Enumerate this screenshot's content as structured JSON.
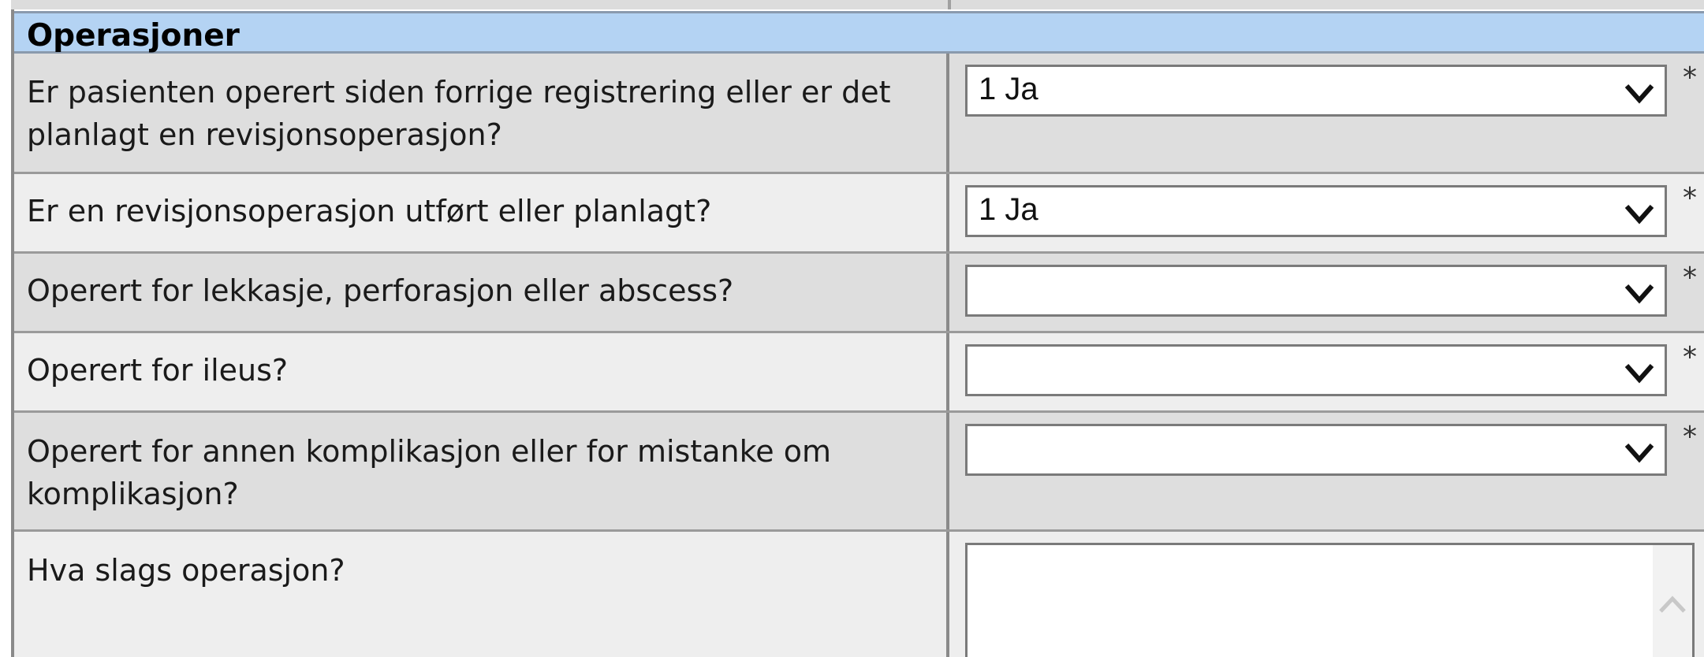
{
  "section": {
    "title": "Operasjoner"
  },
  "questions": [
    {
      "label": "Er pasienten operert siden forrige registrering eller er det planlagt en revisjonsoperasjon?",
      "value": "1 Ja",
      "required": "*"
    },
    {
      "label": "Er en revisjonsoperasjon utført eller planlagt?",
      "value": "1 Ja",
      "required": "*"
    },
    {
      "label": "Operert for lekkasje, perforasjon eller abscess?",
      "value": "",
      "required": "*"
    },
    {
      "label": "Operert for ileus?",
      "value": "",
      "required": "*"
    },
    {
      "label": "Operert for annen komplikasjon eller for mistanke om komplikasjon?",
      "value": "",
      "required": "*"
    },
    {
      "label": "Hva slags operasjon?",
      "value": ""
    }
  ],
  "icons": {
    "dropdown": "chevron-down-icon",
    "scroll_up": "chevron-up-icon"
  }
}
